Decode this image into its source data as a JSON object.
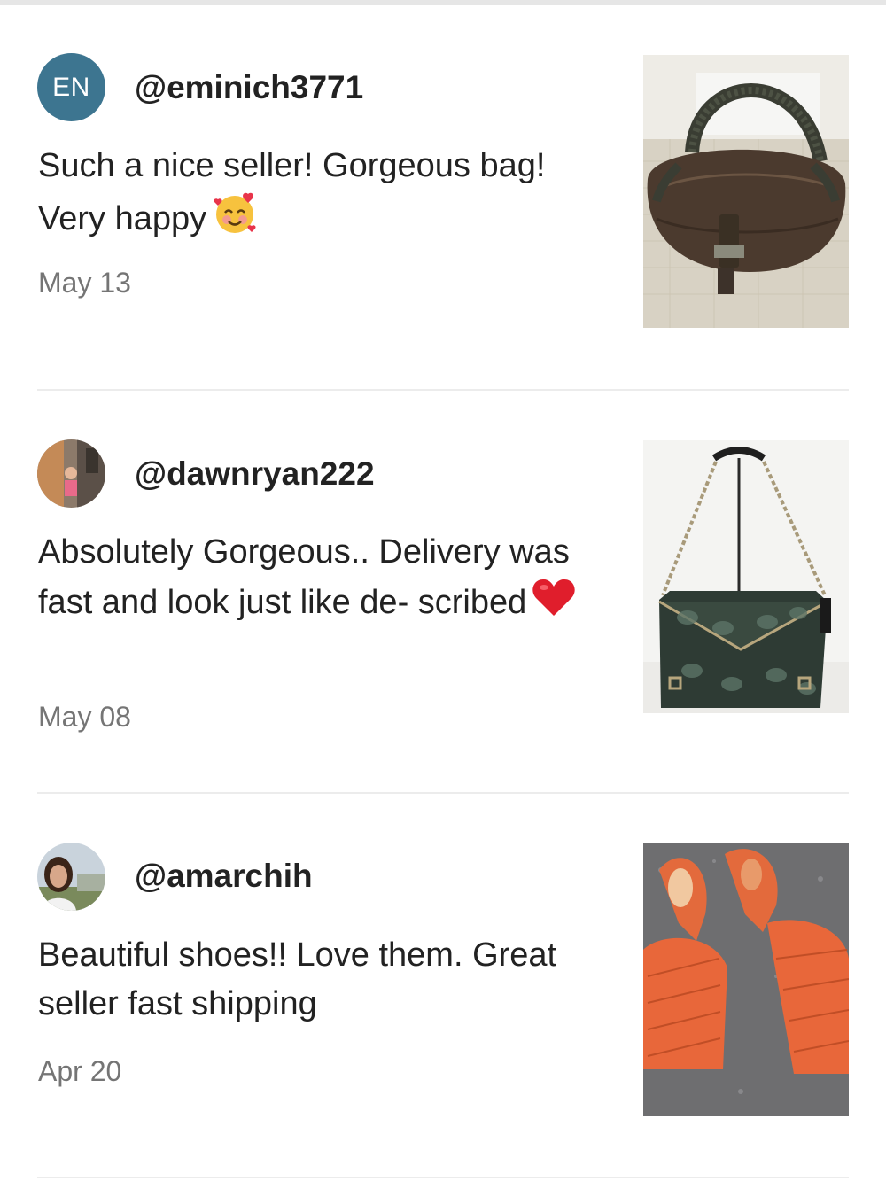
{
  "reviews": [
    {
      "avatar": {
        "type": "initials",
        "initials": "EN",
        "color": "#3d7590"
      },
      "username": "@eminich3771",
      "text": "Such a nice seller! Gorgeous bag! Very happy",
      "emoji": "smiling-face-with-hearts",
      "date": "May 13",
      "photo_icon": "brown-leather-spy-bag"
    },
    {
      "avatar": {
        "type": "photo",
        "icon": "user-photo-child"
      },
      "username": "@dawnryan222",
      "text": "Absolutely Gorgeous.. Delivery was fast and look just like de- scribed",
      "emoji": "red-heart",
      "date": "May 08",
      "photo_icon": "python-print-chain-shoulder-bag"
    },
    {
      "avatar": {
        "type": "photo",
        "icon": "user-photo-woman"
      },
      "username": "@amarchih",
      "text": "Beautiful shoes!! Love them. Great seller fast shipping",
      "emoji": "",
      "date": "Apr 20",
      "photo_icon": "orange-quilted-mule-sandals"
    }
  ],
  "colors": {
    "text": "#222222",
    "date": "#757575",
    "divider": "#ececec",
    "avatar_initials_bg": "#3d7590"
  }
}
